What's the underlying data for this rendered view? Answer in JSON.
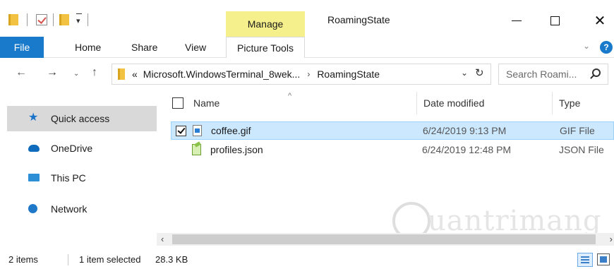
{
  "titlebar": {
    "contextual_tab": "Manage",
    "window_title": "RoamingState",
    "close_glyph": "✕"
  },
  "ribbon": {
    "tabs": [
      "File",
      "Home",
      "Share",
      "View",
      "Picture Tools"
    ],
    "help_glyph": "?",
    "chevron_glyph": "⌄"
  },
  "nav": {
    "back_glyph": "←",
    "forward_glyph": "→",
    "recent_glyph": "⌄",
    "up_glyph": "↑",
    "address": {
      "overflow": "«",
      "parts": [
        "Microsoft.WindowsTerminal_8wek...",
        "RoamingState"
      ],
      "separator": "›",
      "dropdown_glyph": "⌄",
      "refresh_glyph": "↻"
    },
    "search_placeholder": "Search Roami..."
  },
  "navpane": {
    "items": [
      {
        "label": "Quick access",
        "icon": "star-icon"
      },
      {
        "label": "OneDrive",
        "icon": "cloud-icon"
      },
      {
        "label": "This PC",
        "icon": "computer-icon"
      },
      {
        "label": "Network",
        "icon": "network-icon"
      }
    ]
  },
  "content": {
    "columns": [
      "Name",
      "Date modified",
      "Type"
    ],
    "sort_glyph": "^",
    "rows": [
      {
        "name": "coffee.gif",
        "date": "6/24/2019 9:13 PM",
        "type": "GIF File",
        "selected": true,
        "checked": true
      },
      {
        "name": "profiles.json",
        "date": "6/24/2019 12:48 PM",
        "type": "JSON File",
        "selected": false,
        "checked": false
      }
    ]
  },
  "scrollbar": {
    "left_glyph": "‹",
    "right_glyph": "›"
  },
  "watermark": {
    "text": "uantrimang"
  },
  "status": {
    "item_count": "2 items",
    "selection": "1 item selected",
    "size": "28.3 KB"
  },
  "colors": {
    "file_tab": "#1979ca",
    "manage_tab": "#f6f08c",
    "selection_bg": "#cce8ff",
    "nav_active_bg": "#d9d9d9"
  }
}
